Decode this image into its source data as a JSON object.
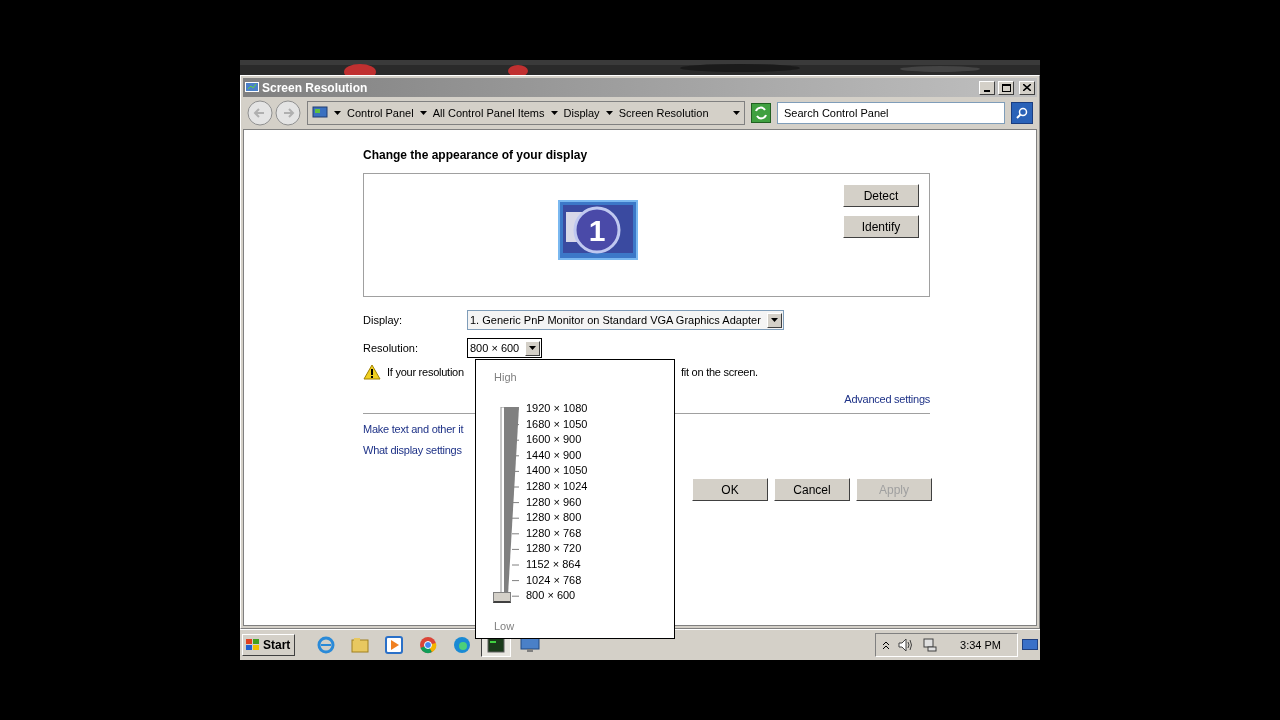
{
  "window": {
    "title": "Screen Resolution"
  },
  "address_bar": {
    "breadcrumbs": [
      "Control Panel",
      "All Control Panel Items",
      "Display",
      "Screen Resolution"
    ]
  },
  "search": {
    "placeholder": "Search Control Panel"
  },
  "heading": "Change the appearance of your display",
  "monitor": {
    "number": "1"
  },
  "side_buttons": [
    "Detect",
    "Identify"
  ],
  "display": {
    "label": "Display:",
    "value": "1. Generic PnP Monitor on Standard VGA Graphics Adapter"
  },
  "resolution": {
    "label": "Resolution:",
    "value": "800 × 600",
    "expanded": true
  },
  "warning": {
    "text_start": "If your resolution",
    "text_end": "fit on the screen."
  },
  "advanced_link": "Advanced settings",
  "links": [
    "Make text and other it",
    "What display settings"
  ],
  "dialog_buttons": [
    {
      "label": "OK",
      "disabled": false
    },
    {
      "label": "Cancel",
      "disabled": false
    },
    {
      "label": "Apply",
      "disabled": true
    }
  ],
  "resolution_popup": {
    "high_label": "High",
    "low_label": "Low",
    "options": [
      {
        "label": "1920 × 1080",
        "selected": false
      },
      {
        "label": "1680 × 1050",
        "selected": false
      },
      {
        "label": "1600 × 900",
        "selected": false
      },
      {
        "label": "1440 × 900",
        "selected": false
      },
      {
        "label": "1400 × 1050",
        "selected": false
      },
      {
        "label": "1280 × 1024",
        "selected": false
      },
      {
        "label": "1280 × 960",
        "selected": false
      },
      {
        "label": "1280 × 800",
        "selected": false
      },
      {
        "label": "1280 × 768",
        "selected": false
      },
      {
        "label": "1280 × 720",
        "selected": false
      },
      {
        "label": "1152 × 864",
        "selected": false
      },
      {
        "label": "1024 × 768",
        "selected": false
      },
      {
        "label": "800 × 600",
        "selected": true
      }
    ]
  },
  "taskbar": {
    "start": "Start",
    "items": [
      {
        "kind": "browser-e",
        "selected": false
      },
      {
        "kind": "folder",
        "selected": false
      },
      {
        "kind": "media",
        "selected": false
      },
      {
        "kind": "chrome",
        "selected": false
      },
      {
        "kind": "edge",
        "selected": false
      },
      {
        "kind": "terminal",
        "selected": true
      },
      {
        "kind": "display",
        "selected": false
      }
    ],
    "clock": "3:34 PM"
  }
}
